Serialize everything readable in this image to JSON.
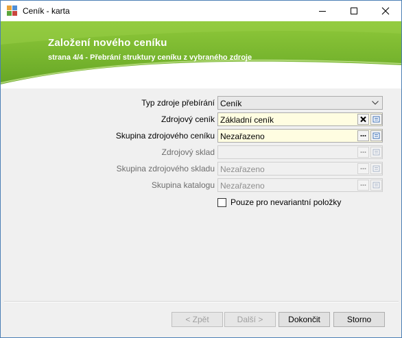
{
  "window": {
    "title": "Ceník - karta",
    "colors": {
      "border": "#4a7eb5",
      "banner": "#77b52e",
      "required_field": "#fffde1"
    }
  },
  "banner": {
    "title": "Založení nového ceníku",
    "subtitle": "strana 4/4 - Přebrání struktury ceníku z vybraného zdroje"
  },
  "form": {
    "rows": [
      {
        "label": "Typ zdroje přebírání",
        "value": "Ceník",
        "kind": "combo",
        "enabled": true
      },
      {
        "label": "Zdrojový ceník",
        "value": "Základní ceník",
        "kind": "lookup-clear",
        "enabled": true,
        "required": true
      },
      {
        "label": "Skupina zdrojového ceníku",
        "value": "Nezařazeno",
        "kind": "lookup",
        "enabled": true,
        "required": true
      },
      {
        "label": "Zdrojový sklad",
        "value": "",
        "kind": "lookup",
        "enabled": false
      },
      {
        "label": "Skupina zdrojového skladu",
        "value": "Nezařazeno",
        "kind": "lookup",
        "enabled": false
      },
      {
        "label": "Skupina katalogu",
        "value": "Nezařazeno",
        "kind": "lookup",
        "enabled": false
      }
    ],
    "checkbox": {
      "label": "Pouze pro nevariantní položky",
      "checked": false
    }
  },
  "footer": {
    "back": "< Zpět",
    "next": "Další >",
    "finish": "Dokončit",
    "cancel": "Storno"
  }
}
